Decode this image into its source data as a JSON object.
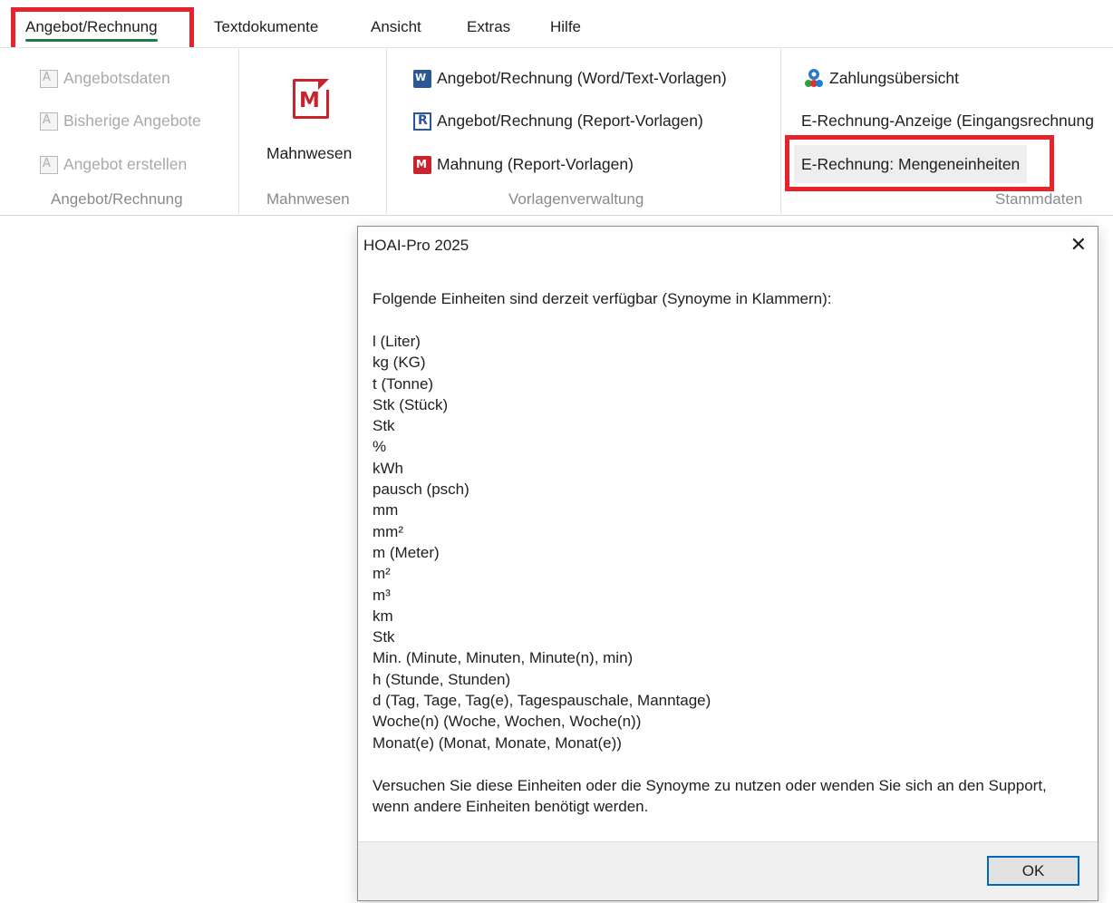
{
  "menubar": {
    "items": [
      {
        "label": "Angebot/Rechnung",
        "active": true
      },
      {
        "label": "Textdokumente"
      },
      {
        "label": "Ansicht"
      },
      {
        "label": "Extras"
      },
      {
        "label": "Hilfe"
      }
    ]
  },
  "ribbon": {
    "angebot_group": {
      "items": [
        {
          "label": "Angebotsdaten",
          "icon": "document-data-icon",
          "enabled": false
        },
        {
          "label": "Bisherige Angebote",
          "icon": "document-history-icon",
          "enabled": false
        },
        {
          "label": "Angebot erstellen",
          "icon": "document-create-icon",
          "enabled": false
        }
      ],
      "label": "Angebot/Rechnung"
    },
    "mahnwesen_group": {
      "button_label": "Mahnwesen",
      "icon": "mahnwesen-icon",
      "label": "Mahnwesen"
    },
    "vorlagen_group": {
      "items": [
        {
          "label": "Angebot/Rechnung (Word/Text-Vorlagen)",
          "icon": "word-icon"
        },
        {
          "label": "Angebot/Rechnung (Report-Vorlagen)",
          "icon": "report-icon"
        },
        {
          "label": "Mahnung (Report-Vorlagen)",
          "icon": "mahnung-icon"
        }
      ],
      "label": "Vorlagenverwaltung"
    },
    "stammdaten_group": {
      "items": [
        {
          "label": "Zahlungsübersicht",
          "icon": "payment-overview-icon"
        },
        {
          "label": "E-Rechnung-Anzeige (Eingangsrechnung"
        },
        {
          "label": "E-Rechnung: Mengeneinheiten"
        }
      ],
      "label": "Stammdaten"
    }
  },
  "dialog": {
    "title": "HOAI-Pro 2025",
    "intro": "Folgende Einheiten sind derzeit verfügbar (Synoyme in Klammern):",
    "units": [
      "l (Liter)",
      "kg (KG)",
      "t (Tonne)",
      "Stk (Stück)",
      "Stk",
      "%",
      "kWh",
      "pausch (psch)",
      "mm",
      "mm²",
      "m (Meter)",
      "m²",
      "m³",
      "km",
      "Stk",
      "Min. (Minute, Minuten, Minute(n), min)",
      "h (Stunde, Stunden)",
      "d (Tag, Tage, Tag(e), Tagespauschale, Manntage)",
      "Woche(n) (Woche, Wochen, Woche(n))",
      "Monat(e) (Monat, Monate, Monat(e))"
    ],
    "footer_text": "Versuchen Sie diese Einheiten oder die Synoyme zu nutzen oder wenden Sie sich an den Support, wenn andere Einheiten benötigt werden.",
    "ok_label": "OK",
    "close_glyph": "✕"
  },
  "colors": {
    "highlight_red": "#e3242b",
    "active_underline": "#1f7a3f",
    "ok_border": "#0067c0",
    "disabled_text": "#a9a9a9"
  }
}
